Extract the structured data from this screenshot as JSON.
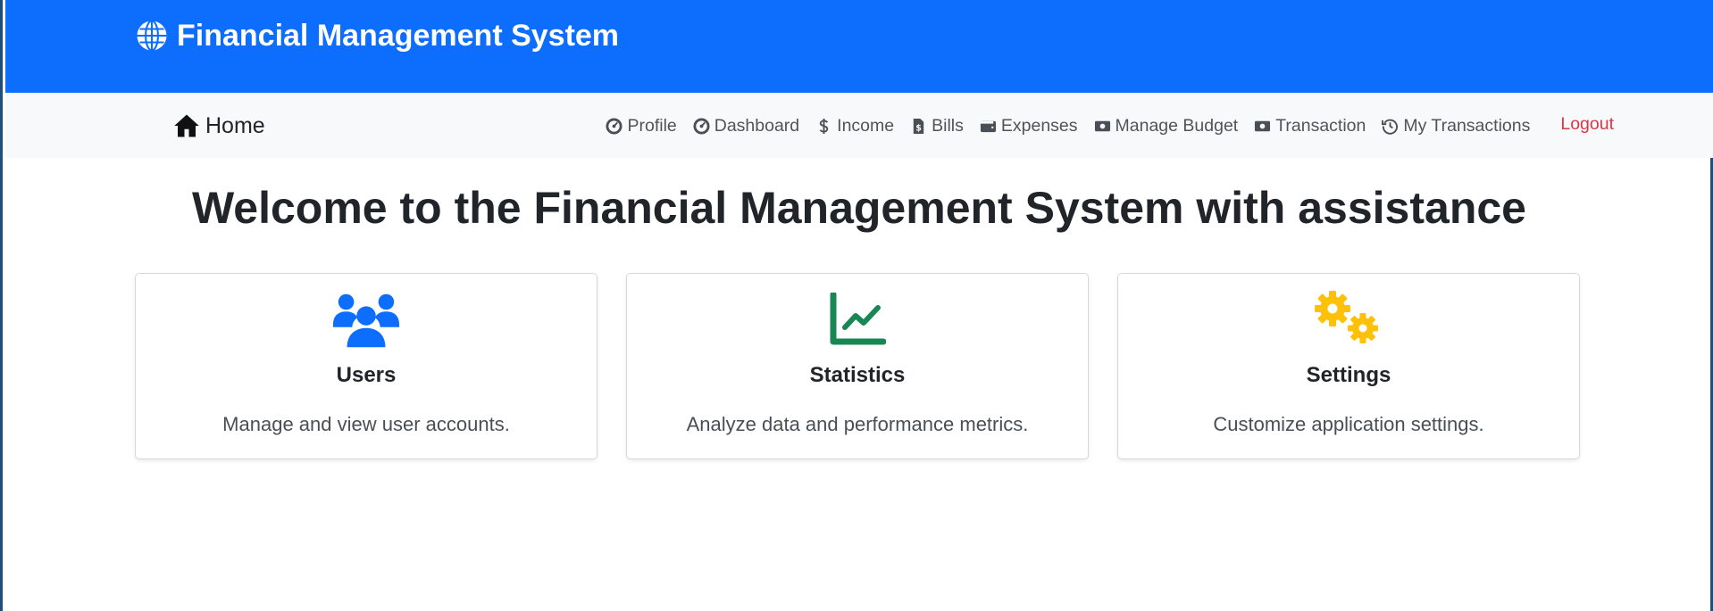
{
  "header": {
    "brand_title": "Financial Management System",
    "brand_icon": "globe-icon",
    "background_color": "#0d6efd"
  },
  "nav": {
    "home_label": "Home",
    "home_icon": "house-icon",
    "items": [
      {
        "label": "Profile",
        "icon": "gauge-icon"
      },
      {
        "label": "Dashboard",
        "icon": "gauge-icon"
      },
      {
        "label": "Income",
        "icon": "dollar-icon"
      },
      {
        "label": "Bills",
        "icon": "receipt-icon"
      },
      {
        "label": "Expenses",
        "icon": "wallet-icon"
      },
      {
        "label": "Manage Budget",
        "icon": "money-bill-icon"
      },
      {
        "label": "Transaction",
        "icon": "money-bill-icon"
      },
      {
        "label": "My Transactions",
        "icon": "history-icon"
      }
    ],
    "logout_label": "Logout",
    "logout_color": "#dc3545"
  },
  "main": {
    "welcome_heading": "Welcome to the Financial Management System with assistance",
    "cards": [
      {
        "title": "Users",
        "text": "Manage and view user accounts.",
        "icon": "users-icon",
        "icon_color": "#0d6efd"
      },
      {
        "title": "Statistics",
        "text": "Analyze data and performance metrics.",
        "icon": "chart-line-icon",
        "icon_color": "#198754"
      },
      {
        "title": "Settings",
        "text": "Customize application settings.",
        "icon": "gears-icon",
        "icon_color": "#ffc107"
      }
    ]
  }
}
